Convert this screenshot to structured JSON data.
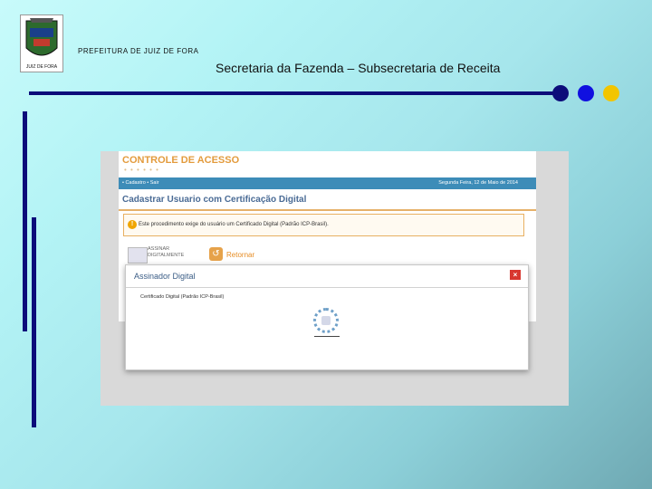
{
  "header": {
    "organization": "PREFEITURA DE JUIZ DE FORA",
    "subtitle": "Secretaria da Fazenda – Subsecretaria de Receita",
    "crest_text": "JUIZ DE FORA"
  },
  "decor": {
    "line_color": "#0c0c7a",
    "dots": [
      "#0c0c7a",
      "#1010e0",
      "#f2c500"
    ]
  },
  "screenshot": {
    "app_title": "CONTROLE DE ACESSO",
    "nav_left": "• Cadastro  •  Sair",
    "nav_date": "Segunda Feira, 12 de Maio de 2014",
    "page_heading": "Cadastrar Usuario com Certificação Digital",
    "notice_text": "Este procedimento exige do usuário um Certificado Digital (Padrão ICP-Brasil).",
    "sign_label": "ASSINAR DIGITALMENTE",
    "return_label": "Retornar",
    "modal": {
      "title": "Assinador Digital",
      "close": "×",
      "cert_label": "Certificado Digital (Padrão ICP-Brasil)"
    }
  }
}
